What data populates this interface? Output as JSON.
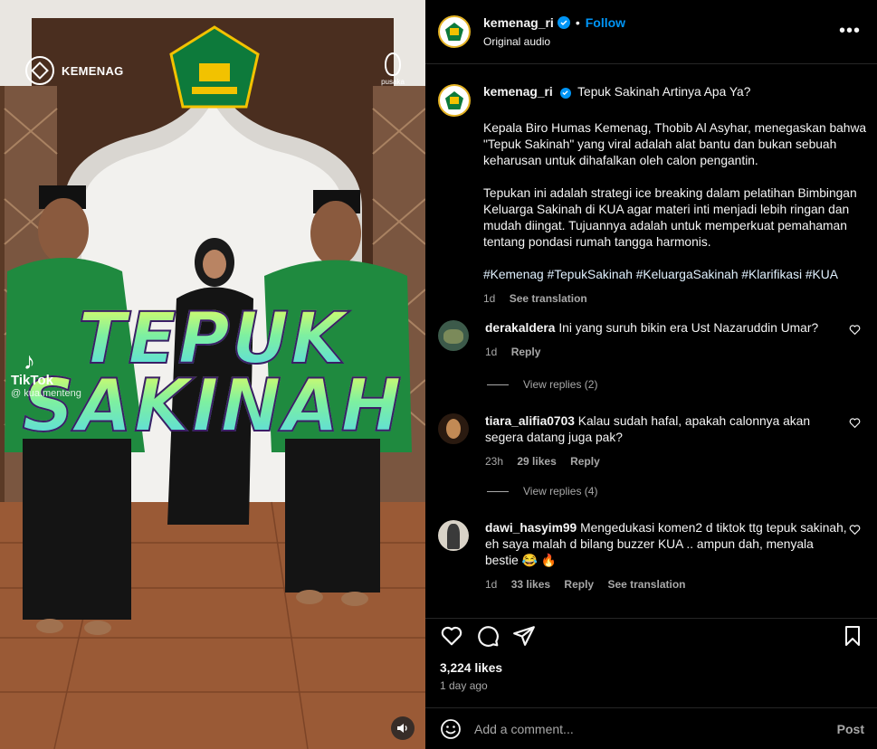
{
  "media": {
    "brand_left": "KEMENAG",
    "brand_right": "pusaka",
    "watermark_app": "TikTok",
    "watermark_handle": "@ kua.menteng",
    "overlay_title_line1": "TEPUK",
    "overlay_title_line2": "SAKINAH",
    "volume_icon": "volume-icon"
  },
  "header": {
    "username": "kemenag_ri",
    "verified": true,
    "separator": "•",
    "follow_label": "Follow",
    "audio_label": "Original audio",
    "more_label": "•••"
  },
  "caption": {
    "username": "kemenag_ri",
    "title": "Tepuk Sakinah Artinya Apa Ya?",
    "paragraph1": "Kepala Biro Humas Kemenag, Thobib Al Asyhar, menegaskan bahwa \"Tepuk Sakinah\" yang viral adalah alat bantu dan bukan sebuah keharusan untuk dihafalkan oleh calon pengantin.",
    "paragraph2": "Tepukan ini adalah strategi ice breaking dalam pelatihan Bimbingan Keluarga Sakinah di KUA agar materi inti menjadi lebih ringan dan mudah diingat. Tujuannya adalah untuk memperkuat pemahaman tentang pondasi rumah tangga harmonis.",
    "hashtags": "#Kemenag #TepukSakinah #KeluargaSakinah #Klarifikasi #KUA",
    "time": "1d",
    "see_translation": "See translation"
  },
  "comments": [
    {
      "username": "derakaldera",
      "text": "Ini yang suruh bikin era Ust Nazaruddin Umar?",
      "time": "1d",
      "likes": "",
      "reply": "Reply",
      "view_replies": "View replies (2)"
    },
    {
      "username": "tiara_alifia0703",
      "text": "Kalau sudah hafal, apakah calonnya akan segera datang juga pak?",
      "time": "23h",
      "likes": "29 likes",
      "reply": "Reply",
      "view_replies": "View replies (4)"
    },
    {
      "username": "dawi_hasyim99",
      "text": "Mengedukasi komen2 d tiktok ttg tepuk sakinah, eh saya malah d bilang buzzer KUA .. ampun dah, menyala bestie 😂 🔥",
      "time": "1d",
      "likes": "33 likes",
      "reply": "Reply",
      "see_translation": "See translation"
    }
  ],
  "footer": {
    "likes": "3,224 likes",
    "ago": "1 day ago",
    "add_comment_placeholder": "Add a comment...",
    "post_label": "Post"
  },
  "colors": {
    "accent": "#0095f6",
    "background": "#000000",
    "secondary_text": "#a8a8a8"
  }
}
